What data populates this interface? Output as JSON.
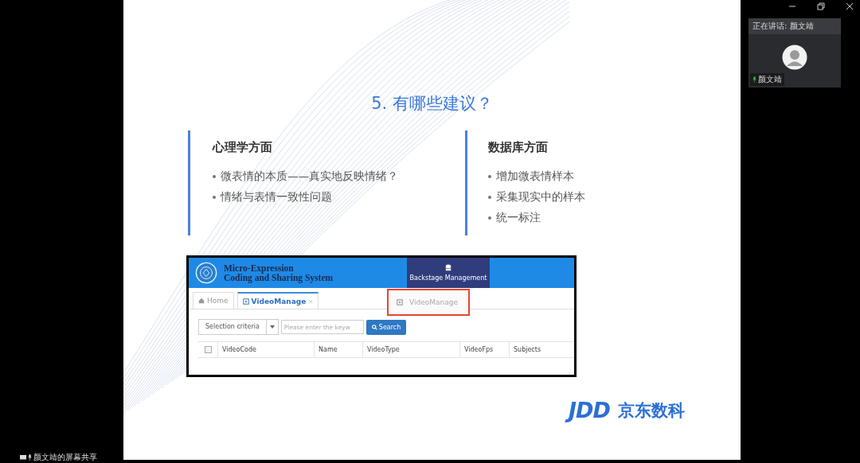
{
  "slide": {
    "title": "5. 有哪些建议？",
    "columns": [
      {
        "heading": "心理学方面",
        "bullets": [
          "微表情的本质——真实地反映情绪？",
          "情绪与表情一致性问题"
        ]
      },
      {
        "heading": "数据库方面",
        "bullets": [
          "增加微表情样本",
          "采集现实中的样本",
          "统一标注"
        ]
      }
    ],
    "embedded_app": {
      "system_title": [
        "Micro-Expression",
        "Coding and Sharing System"
      ],
      "nav_item": {
        "label": "Backstage Management",
        "selected": true
      },
      "tabs": [
        {
          "label": "Home",
          "selected": false,
          "closable": false
        },
        {
          "label": "VideoManage",
          "selected": true,
          "closable": true
        }
      ],
      "dropdown_item": "VideoManage",
      "toolbar": {
        "criteria": "Selection criteria",
        "placeholder": "Please enter the keyw",
        "search_button": "Search"
      },
      "table": {
        "select_all_checked": false,
        "columns": [
          "VideoCode",
          "Name",
          "VideoType",
          "VideoFps",
          "Subjects"
        ]
      }
    },
    "logo": {
      "mark": "JDD",
      "text": "京东数科"
    }
  },
  "speaker_panel": {
    "speaking_label": "正在讲话: 颜文靖",
    "participant_name": "颜文靖"
  },
  "share_label": "颜文靖的屏幕共享"
}
